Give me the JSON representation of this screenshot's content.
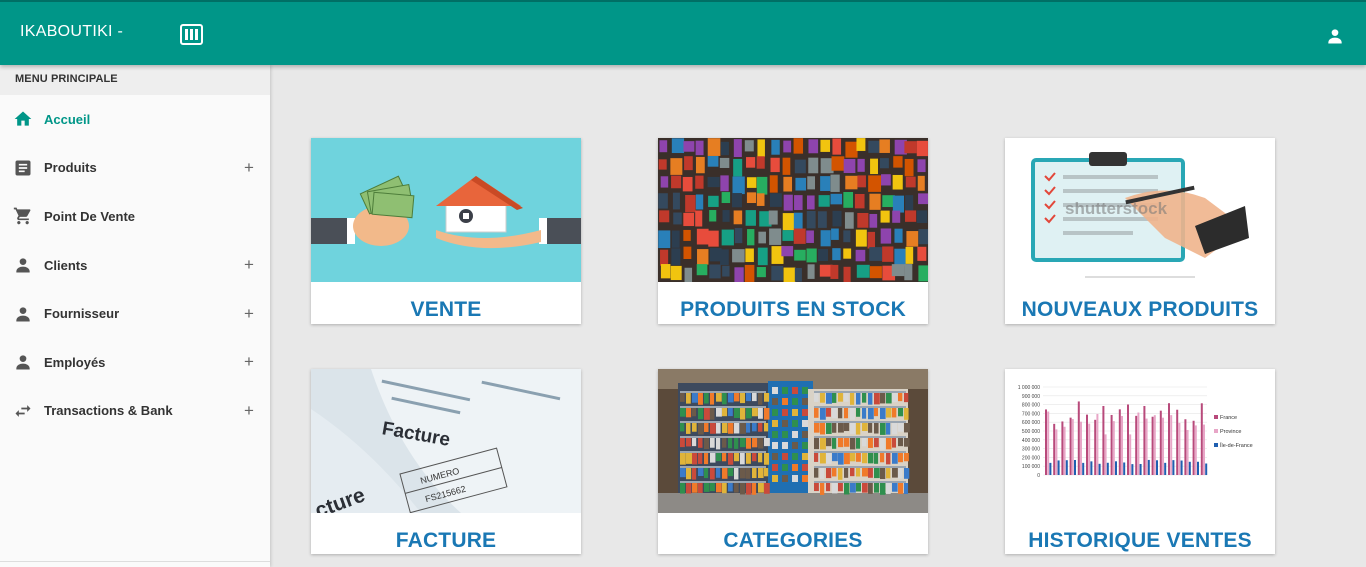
{
  "header": {
    "brand": "IKABOUTIKI -",
    "menu_icon": "view-columns-icon",
    "user_icon": "person-icon",
    "accent_color": "#009688"
  },
  "sidebar": {
    "title": "MENU PRINCIPALE",
    "items": [
      {
        "label": "Accueil",
        "icon": "home-icon",
        "active": true,
        "expandable": false
      },
      {
        "label": "Produits",
        "icon": "document-list-icon",
        "active": false,
        "expandable": true,
        "expand_symbol": "+"
      },
      {
        "label": "Point De Vente",
        "icon": "cart-icon",
        "active": false,
        "expandable": false
      },
      {
        "label": "Clients",
        "icon": "person-icon",
        "active": false,
        "expandable": true,
        "expand_symbol": "+"
      },
      {
        "label": "Fournisseur",
        "icon": "person-icon",
        "active": false,
        "expandable": true,
        "expand_symbol": "+"
      },
      {
        "label": "Employés",
        "icon": "person-icon",
        "active": false,
        "expandable": true,
        "expand_symbol": "+"
      },
      {
        "label": "Transactions & Bank",
        "icon": "swap-arrows-icon",
        "active": false,
        "expandable": true,
        "expand_symbol": "+"
      }
    ]
  },
  "cards": [
    {
      "title": "VENTE",
      "image": "money-for-house-illustration"
    },
    {
      "title": "PRODUITS EN STOCK",
      "image": "hardware-store-shelves-photo"
    },
    {
      "title": "NOUVEAUX PRODUITS",
      "image": "clipboard-checklist-illustration",
      "watermark": "shutterstock"
    },
    {
      "title": "FACTURE",
      "image": "invoice-document-photo",
      "doc_text": "Facture",
      "doc_text_2": "cture",
      "doc_field": "NUMERO",
      "doc_value": "FS215662"
    },
    {
      "title": "CATEGORIES",
      "image": "store-aisle-photo"
    },
    {
      "title": "HISTORIQUE VENTES",
      "image": "sales-bar-chart",
      "chart_legend": [
        "France",
        "Province",
        "Île-de-France"
      ],
      "chart_yticks": [
        "1 000 000",
        "900 000",
        "800 000",
        "700 000",
        "600 000",
        "500 000",
        "400 000",
        "300 000",
        "200 000",
        "100 000",
        "0"
      ]
    }
  ]
}
